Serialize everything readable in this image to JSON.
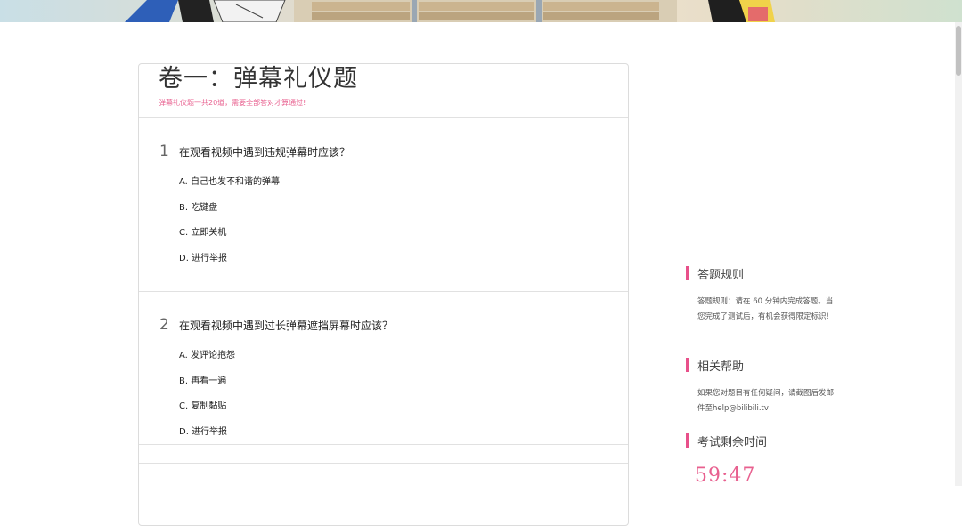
{
  "exam": {
    "title": "卷一：弹幕礼仪题",
    "subtitle": "弹幕礼仪题一共20道，需要全部答对才算通过!"
  },
  "questions": [
    {
      "number": "1",
      "text": "在观看视频中遇到违规弹幕时应该？",
      "options": [
        "A. 自己也发不和谐的弹幕",
        "B. 吃键盘",
        "C. 立即关机",
        "D. 进行举报"
      ]
    },
    {
      "number": "2",
      "text": "在观看视频中遇到过长弹幕遮挡屏幕时应该？",
      "options": [
        "A. 发评论抱怨",
        "B. 再看一遍",
        "C. 复制黏贴",
        "D. 进行举报"
      ]
    }
  ],
  "sidebar": {
    "rules": {
      "title": "答题规则",
      "body": "答题规则：请在 60 分钟内完成答题。当您完成了测试后，有机会获得限定标识!"
    },
    "help": {
      "title": "相关帮助",
      "body": "如果您对题目有任何疑问，请截图后发邮件至help@bilibili.tv"
    },
    "timer": {
      "title": "考试剩余时间",
      "value": "59:47"
    }
  },
  "colors": {
    "accent": "#e8508a",
    "subtitle": "#e8608f"
  }
}
